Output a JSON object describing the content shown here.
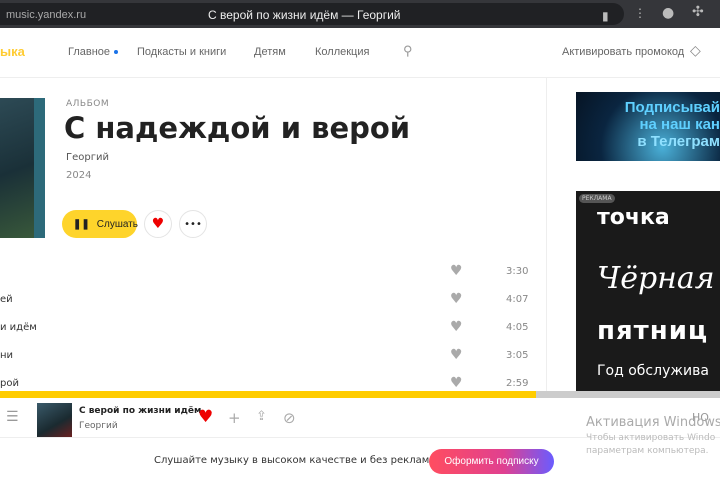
{
  "browser": {
    "url": "music.yandex.ru",
    "page_title": "С верой по жизни идём — Георгий"
  },
  "header": {
    "logo": "ыка",
    "nav": [
      "Главное",
      "Подкасты и книги",
      "Детям",
      "Коллекция"
    ],
    "promo": "Активировать промокод"
  },
  "album": {
    "type": "АЛЬБОМ",
    "title": "С надеждой и верой",
    "artist": "Георгий",
    "year": "2024",
    "play_label": "Слушать"
  },
  "tracks": [
    {
      "name": "",
      "duration": "3:30"
    },
    {
      "name": "ей",
      "duration": "4:07"
    },
    {
      "name": "и идём",
      "duration": "4:05"
    },
    {
      "name": "ни",
      "duration": "3:05"
    },
    {
      "name": "рой",
      "duration": "2:59"
    }
  ],
  "ads": {
    "telegram": [
      "Подписывай",
      "на наш кан",
      "в Телеграм"
    ],
    "label": "РЕКЛАМА",
    "brand": "точка",
    "line1": "Чёрная",
    "line2": "пятниц",
    "line3": "Год обслужива"
  },
  "player": {
    "title": "С верой по жизни идём",
    "artist": "Георгий",
    "quality": "HQ",
    "progress": 0.744
  },
  "windows": {
    "title": "Активация Windows",
    "line1": "Чтобы активировать Windo",
    "line2": "параметрам компьютера."
  },
  "promo": {
    "text": "Слушайте музыку в высоком качестве и без рекламы",
    "button": "Оформить подписку"
  }
}
